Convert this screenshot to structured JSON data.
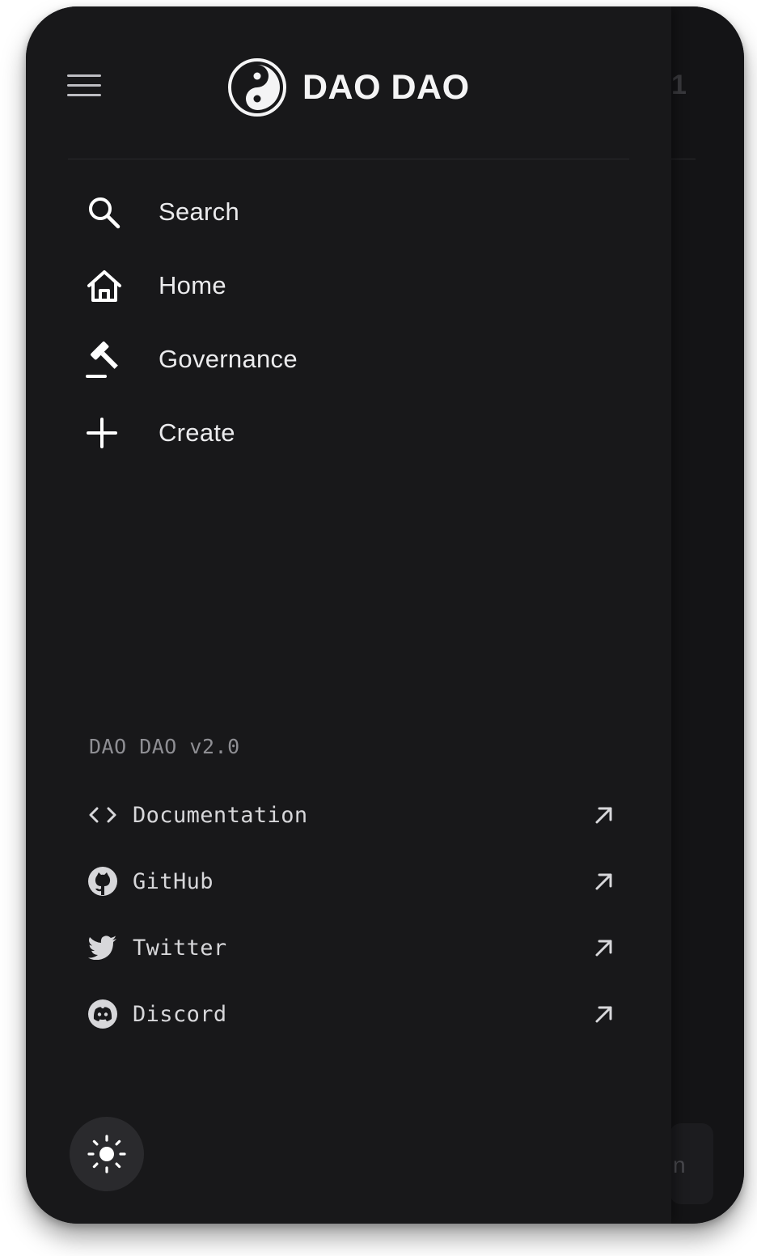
{
  "app": {
    "brand_name": "DAO DAO",
    "version_label": "DAO DAO v2.0"
  },
  "nav": {
    "items": [
      {
        "label": "Search",
        "icon": "search-icon"
      },
      {
        "label": "Home",
        "icon": "home-icon"
      },
      {
        "label": "Governance",
        "icon": "gavel-icon"
      },
      {
        "label": "Create",
        "icon": "plus-icon"
      }
    ]
  },
  "external_links": [
    {
      "label": "Documentation",
      "icon": "code-icon"
    },
    {
      "label": "GitHub",
      "icon": "github-icon"
    },
    {
      "label": "Twitter",
      "icon": "twitter-icon"
    },
    {
      "label": "Discord",
      "icon": "discord-icon"
    }
  ],
  "background_page": {
    "partial_text": "n"
  },
  "colors": {
    "drawer_bg": "#18181a",
    "text_primary": "#ebebed",
    "text_muted": "#8e8e93",
    "theme_button_bg": "#2a2a2d"
  }
}
